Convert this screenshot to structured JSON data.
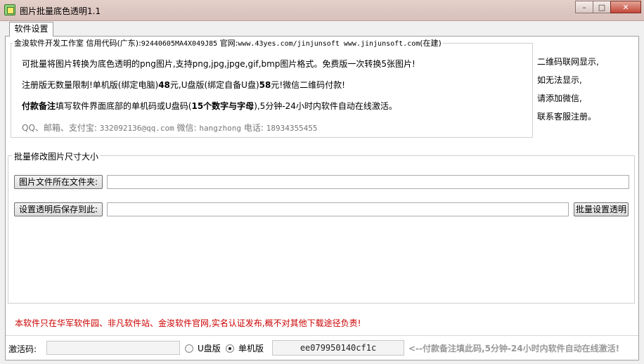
{
  "window": {
    "title": "图片批量底色透明1.1",
    "minimize_glyph": "–",
    "maximize_glyph": "□",
    "close_glyph": "✕"
  },
  "tabs": [
    {
      "label": "软件设置"
    }
  ],
  "info": {
    "legend_prefix": "金浚软件开发工作室 信用代码(广东):",
    "credit_code": "92440605MA4X049J85",
    "site_label": " 官网:",
    "site_url": "www.43yes.com/jinjunsoft  www.jinjunsoft.com",
    "site_suffix": "(在建)",
    "line1": "可批量将图片转换为底色透明的png图片,支持png,jpg,jpge,gif,bmp图片格式。免费版一次转换5张图片!",
    "line2_a": "注册版无数量限制!单机版(绑定电脑)",
    "line2_price1": "48",
    "line2_b": "元,U盘版(绑定自备U盘)",
    "line2_price2": "58",
    "line2_c": "元!微信二维码付款!",
    "line3_bold1": "付款备注",
    "line3_a": "填写软件界面底部的单机码或U盘码(",
    "line3_bold2": "15个数字与字母",
    "line3_b": "),5分钟-24小时内软件自动在线激活。",
    "contact_qq_label": "QQ、邮箱、支付宝: ",
    "contact_qq": "332092136@qq.com",
    "contact_wx_label": "   微信: ",
    "contact_wx": "hangzhong",
    "contact_phone_label": "   电话: ",
    "contact_phone": "18934355455"
  },
  "qr_notice": [
    "二维码联网显示,",
    "如无法显示,",
    "请添加微信,",
    "联系客服注册。"
  ],
  "batch": {
    "legend": "批量修改图片尺寸大小",
    "source_button": "图片文件所在文件夹:",
    "source_value": "",
    "dest_button": "设置透明后保存到此:",
    "dest_value": "",
    "run_button": "批量设置透明"
  },
  "warning": "本软件只在华军软件园、非凡软件站、金浚软件官网,实名认证发布,概不对其他下载途径负责!",
  "activation": {
    "label": "激活码:",
    "value": "",
    "option_usb": "U盘版",
    "option_pc": "单机版",
    "selected": "单机版",
    "machine_code": "ee079950140cf1c",
    "hint": "<--付款备注填此码,5分钟-24小时内软件自动在线激活!"
  },
  "colors": {
    "warning": "#cc0000",
    "hint": "#999999",
    "contact": "#777777"
  }
}
